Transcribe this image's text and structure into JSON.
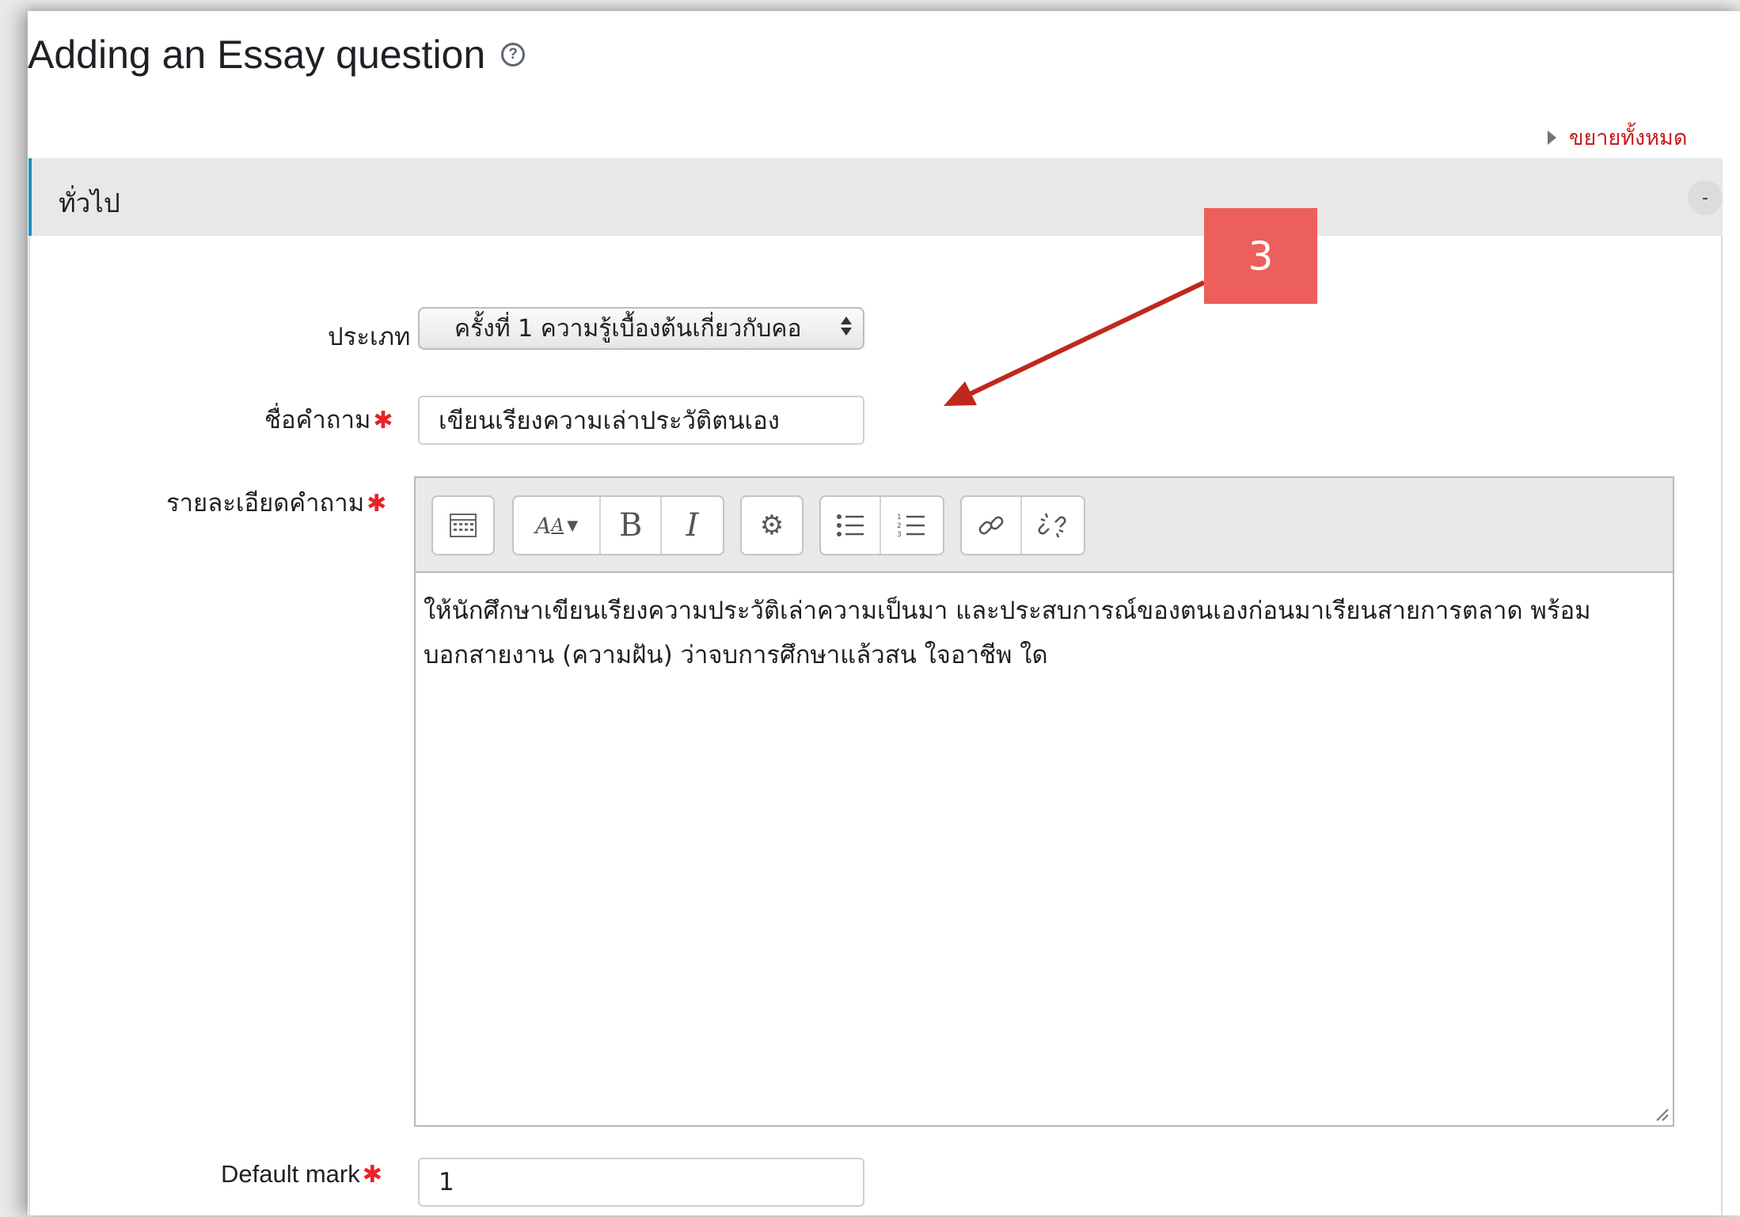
{
  "page": {
    "title": "Adding an Essay question",
    "help_icon": "question-circle-icon",
    "expand_all": "ขยายทั้งหมด"
  },
  "section": {
    "title": "ทั่วไป",
    "collapse_symbol": "-"
  },
  "form": {
    "category": {
      "label": "ประเภท",
      "value": "ครั้งที่ 1 ความรู้เบื้องต้นเกี่ยวกับคอ"
    },
    "question_name": {
      "label": "ชื่อคำถาม",
      "value": "เขียนเรียงความเล่าประวัติตนเอง"
    },
    "question_text": {
      "label": "รายละเอียดคำถาม",
      "lines": [
        "ให้นักศึกษาเขียนเรียงความประวัติเล่าความเป็นมา และประสบการณ์ของตนเองก่อนมาเรียนสายการตลาด พร้อม",
        "บอกสายงาน (ความฝัน) ว่าจบการศึกษาแล้วสน ใจอาชีพ ใด"
      ]
    },
    "default_mark": {
      "label": "Default mark",
      "value": "1"
    },
    "required_marker": "✱"
  },
  "toolbar": {
    "icons": [
      "toolbar-toggle-icon",
      "font-size-icon",
      "bold-icon",
      "italic-icon",
      "settings-icon",
      "bullet-list-icon",
      "numbered-list-icon",
      "link-icon",
      "unlink-icon"
    ],
    "bold_label": "B",
    "italic_label": "I"
  },
  "annotation": {
    "number": "3",
    "color": "#ec5f5a",
    "arrow_color": "#c0281c"
  },
  "colors": {
    "link_red": "#c71c1c",
    "section_accent": "#1f8fbf",
    "required_red": "#e8232a"
  }
}
